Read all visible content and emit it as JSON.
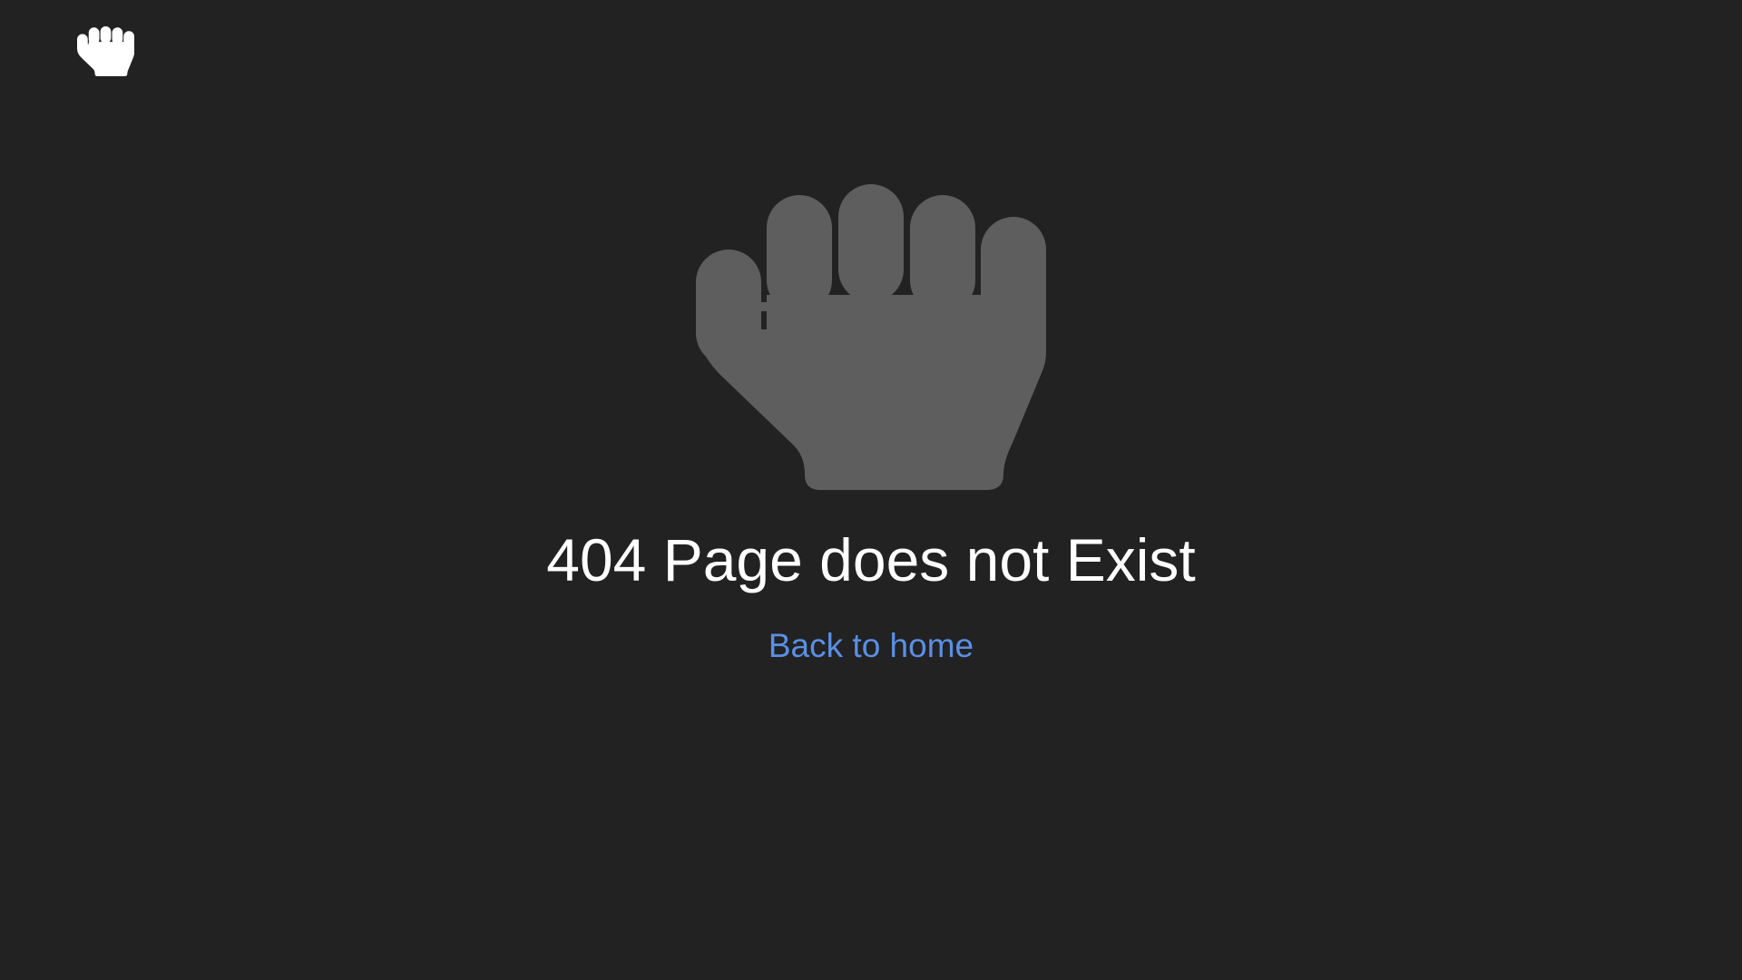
{
  "logo": {
    "icon": "hand-icon",
    "color": "#ffffff"
  },
  "hero": {
    "icon": "hand-icon",
    "color": "#5e5e5e"
  },
  "error": {
    "title": "404 Page does not Exist"
  },
  "navigation": {
    "back_link": "Back to home",
    "link_color": "#5b8fe6"
  },
  "theme": {
    "background": "#222222",
    "text": "#ffffff"
  }
}
